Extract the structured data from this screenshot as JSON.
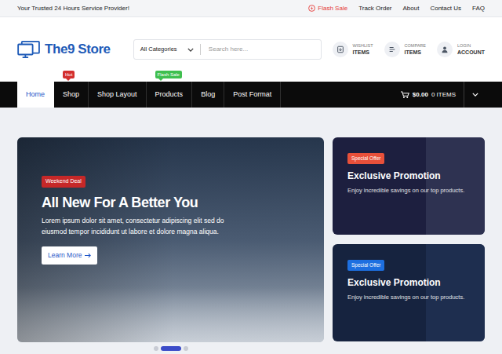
{
  "topbar": {
    "tagline": "Your Trusted 24 Hours Service Provider!",
    "links": [
      {
        "label": "Flash Sale",
        "highlight": true
      },
      {
        "label": "Track Order",
        "highlight": false
      },
      {
        "label": "About",
        "highlight": false
      },
      {
        "label": "Contact Us",
        "highlight": false
      },
      {
        "label": "FAQ",
        "highlight": false
      }
    ]
  },
  "logo": {
    "text": "The9 Store"
  },
  "search": {
    "category": "All Categories",
    "placeholder": "Search here..."
  },
  "header_actions": [
    {
      "label": "WISHLIST",
      "value": "ITEMS"
    },
    {
      "label": "COMPARE",
      "value": "ITEMS"
    },
    {
      "label": "LOGIN",
      "value": "ACCOUNT"
    }
  ],
  "nav": {
    "items": [
      {
        "label": "Home",
        "selected": true
      },
      {
        "label": "Shop",
        "selected": false,
        "badge": {
          "text": "Hot",
          "color": "#d32f2f"
        }
      },
      {
        "label": "Shop Layout",
        "selected": false
      },
      {
        "label": "Products",
        "selected": false,
        "badge": {
          "text": "Flash Sale",
          "color": "#3fbf4f"
        }
      },
      {
        "label": "Blog",
        "selected": false
      },
      {
        "label": "Post Format",
        "selected": false
      }
    ],
    "cart": {
      "total": "$0.00",
      "count": "0 ITEMS"
    }
  },
  "hero": {
    "badge": "Weekend Deal",
    "title": "All New For A Better You",
    "text": "Lorem ipsum dolor sit amet, consectetur adipiscing elit sed do eiusmod tempor incididunt ut labore et dolore magna aliqua.",
    "button": "Learn More",
    "slides": [
      {
        "selected": false
      },
      {
        "selected": true
      },
      {
        "selected": false
      }
    ]
  },
  "promos": [
    {
      "badge": "Special Offer",
      "badge_color": "#e8503a",
      "title": "Exclusive Promotion",
      "text": "Enjoy incredible savings on our top products."
    },
    {
      "badge": "Special Offer",
      "badge_color": "#1d6fe0",
      "title": "Exclusive Promotion",
      "text": "Enjoy incredible savings on our top products."
    }
  ]
}
